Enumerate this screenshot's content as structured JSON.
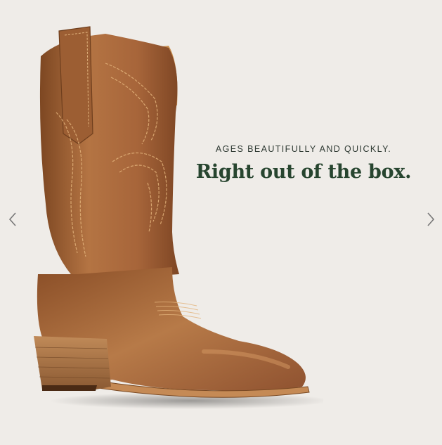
{
  "slide": {
    "eyebrow": "AGES BEAUTIFULLY AND QUICKLY.",
    "headline": "Right out of the box.",
    "image_alt": "brown-leather-western-boot"
  },
  "nav": {
    "prev_icon": "chevron-left-icon",
    "next_icon": "chevron-right-icon"
  },
  "colors": {
    "background": "#efece8",
    "eyebrow_text": "#2f3a33",
    "headline_text": "#27452f",
    "boot_leather": "#a9683a",
    "arrow": "#777777"
  }
}
